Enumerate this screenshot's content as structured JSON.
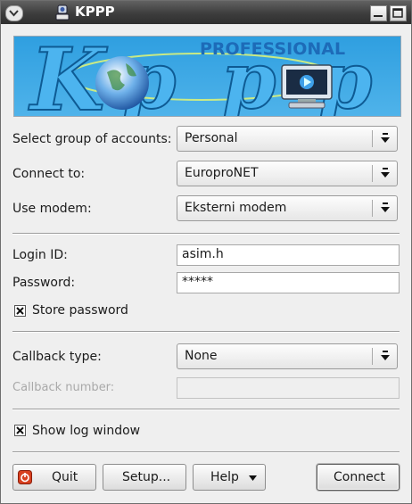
{
  "window": {
    "title": "KPPP"
  },
  "banner": {
    "text_professional": "PROFESSIONAL",
    "logo_letters": [
      "K",
      "p",
      "p",
      "p"
    ]
  },
  "form": {
    "group_label": "Select group of accounts:",
    "group_value": "Personal",
    "connect_label": "Connect to:",
    "connect_value": "EuroproNET",
    "modem_label": "Use modem:",
    "modem_value": "Eksterni modem",
    "login_label": "Login ID:",
    "login_value": "asim.h",
    "password_label": "Password:",
    "password_value": "*****",
    "store_password_label": "Store password",
    "store_password_checked": true,
    "callback_label": "Callback type:",
    "callback_value": "None",
    "callback_number_label": "Callback number:",
    "callback_number_value": "",
    "show_log_label": "Show log window",
    "show_log_checked": true
  },
  "buttons": {
    "quit": "Quit",
    "setup": "Setup...",
    "help": "Help",
    "connect": "Connect"
  },
  "colors": {
    "titlebar": "#3d3d3d",
    "banner_blue": "#3aa6e2",
    "quit_red": "#d8401f"
  }
}
